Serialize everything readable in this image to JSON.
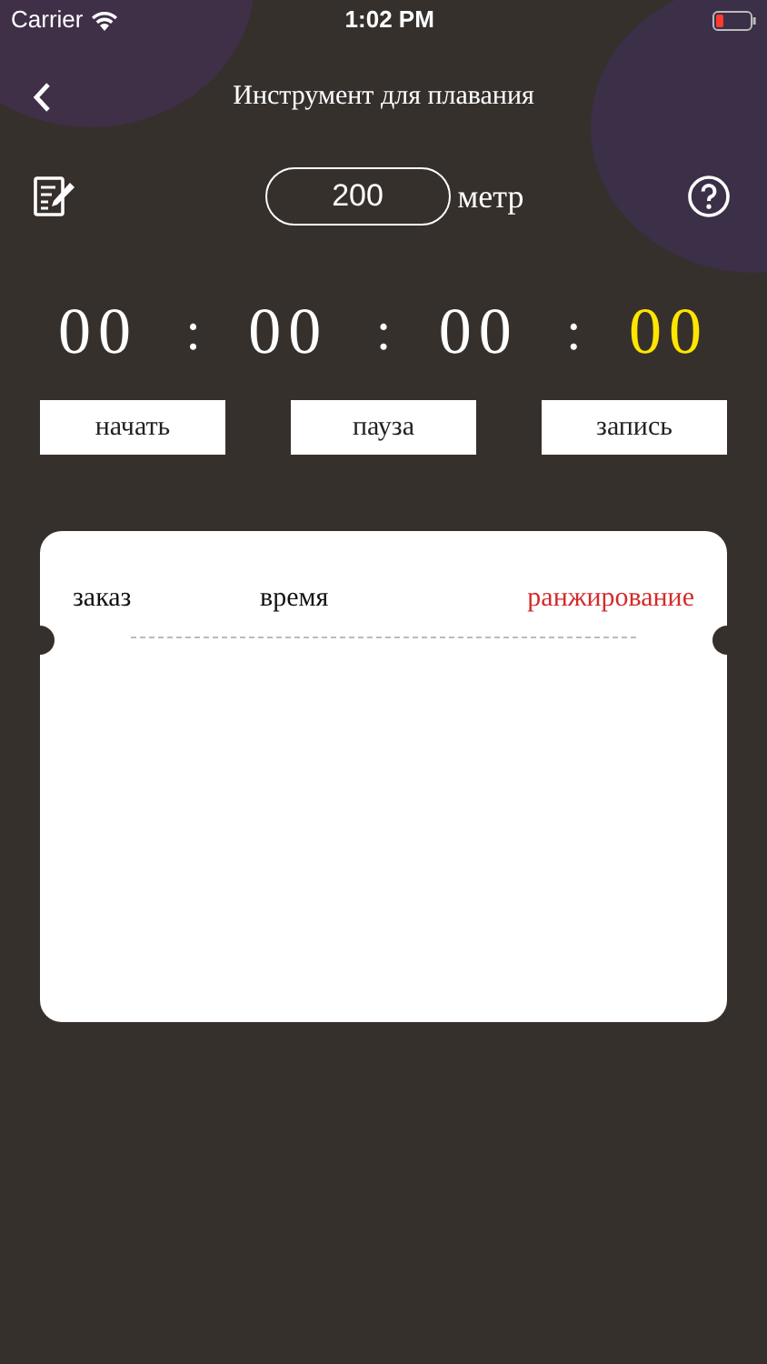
{
  "status_bar": {
    "carrier": "Carrier",
    "time": "1:02 PM",
    "battery_low": true
  },
  "nav": {
    "title": "Инструмент для плавания"
  },
  "distance": {
    "value": "200",
    "unit": "метр"
  },
  "timer": [
    {
      "value": "00",
      "highlighted": false
    },
    {
      "value": "00",
      "highlighted": false
    },
    {
      "value": "00",
      "highlighted": false
    },
    {
      "value": "00",
      "highlighted": true
    }
  ],
  "timer_separators": [
    ":",
    ":",
    ":"
  ],
  "buttons": [
    "начать",
    "пауза",
    "запись"
  ],
  "table": {
    "columns": [
      {
        "label": "заказ",
        "highlighted": false
      },
      {
        "label": "время",
        "highlighted": false
      },
      {
        "label": "ранжирование",
        "highlighted": true
      }
    ]
  }
}
